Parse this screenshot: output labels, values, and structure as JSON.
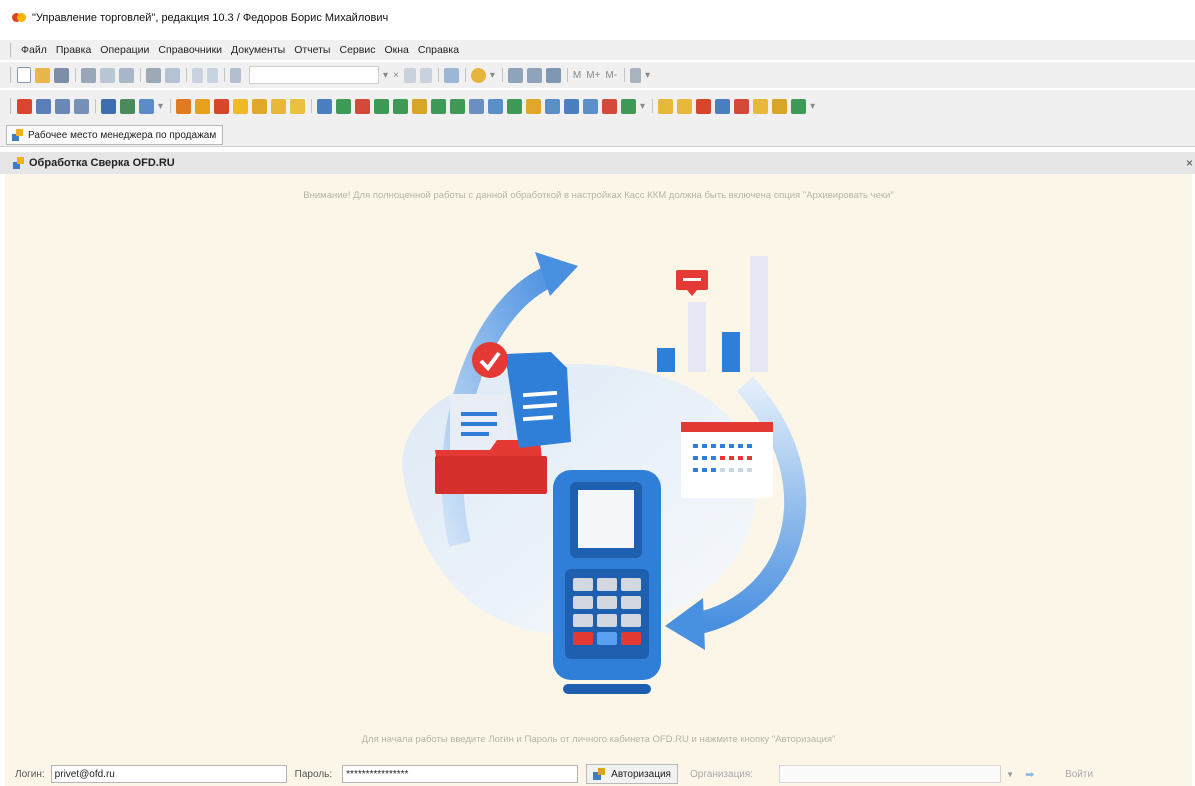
{
  "window": {
    "title": "\"Управление торговлей\", редакция 10.3 / Федоров Борис Михайлович",
    "logo_icon": "1c-logo-icon"
  },
  "menu": [
    "Файл",
    "Правка",
    "Операции",
    "Справочники",
    "Документы",
    "Отчеты",
    "Сервис",
    "Окна",
    "Справка"
  ],
  "toolbar1": {
    "memory_buttons": [
      "M",
      "M+",
      "M-"
    ]
  },
  "open_tab": {
    "label": "Рабочее место менеджера по продажам"
  },
  "form": {
    "title": "Обработка Сверка OFD.RU",
    "close_label": "×"
  },
  "content": {
    "warning": "Внимание! Для полноценной работы с данной обработкой в настройках Касс ККМ должна быть включена опция \"Архивировать чеки\"",
    "hint": "Для начала работы введите Логин и Пароль от личного кабинета OFD.RU и нажмите кнопку \"Авторизация\""
  },
  "login": {
    "login_label": "Логин:",
    "login_value": "privet@ofd.ru",
    "password_label": "Пароль:",
    "password_value": "****************",
    "auth_button": "Авторизация",
    "org_label": "Организация:",
    "org_value": "",
    "go_button": "Войти"
  },
  "colors": {
    "accent_blue": "#2f7fd9",
    "red": "#e53935",
    "content_bg": "#fcf6e9"
  }
}
